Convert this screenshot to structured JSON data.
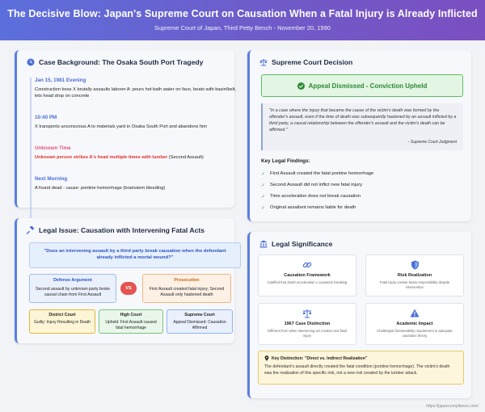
{
  "header": {
    "title": "The Decisive Blow: Japan's Supreme Court on Causation When a Fatal Injury is Already Inflicted",
    "subtitle": "Supreme Court of Japan, Third Petty Bench - November 20, 1990"
  },
  "background": {
    "title": "Case Background: The Osaka South Port Tragedy",
    "events": [
      {
        "time": "Jan 15, 1981 Evening",
        "text": "Construction boss X brutally assaults laborer A: pours hot bath water on face, beats with basin/belt, lets head drop on concrete"
      },
      {
        "time": "10:40 PM",
        "text": "X transports unconscious A to materials yard in Osaka South Port and abandons him"
      },
      {
        "time": "Unknown Time",
        "danger": "Unknown person strikes A's head multiple times with lumber",
        "text_after": " (Second Assault)"
      },
      {
        "time": "Next Morning",
        "text": "A found dead - cause: pontine hemorrhage (brainstem bleeding)"
      }
    ]
  },
  "issue": {
    "title": "Legal Issue: Causation with Intervening Fatal Acts",
    "question": "\"Does an intervening assault by a third party break causation when the defendant already inflicted a mortal wound?\"",
    "defense": {
      "heading": "Defense Argument",
      "text": "Second assault by unknown party broke causal chain from First Assault"
    },
    "vs": "VS",
    "prosecution": {
      "heading": "Prosecution",
      "text": "First Assault created fatal injury; Second Assault only hastened death"
    },
    "courts": [
      {
        "heading": "District Court",
        "text": "Guilty: Injury Resulting in Death"
      },
      {
        "heading": "High Court",
        "text": "Upheld: First Assault caused fatal hemorrhage"
      },
      {
        "heading": "Supreme Court",
        "text": "Appeal Dismissed: Causation Affirmed"
      }
    ]
  },
  "decision": {
    "title": "Supreme Court Decision",
    "result": "Appeal Dismissed - Conviction Upheld",
    "quote": "\"In a case where the injury that became the cause of the victim's death was formed by the offender's assault, even if the time of death was subsequently hastened by an assault inflicted by a third party, a causal relationship between the offender's assault and the victim's death can be affirmed.\"",
    "quote_source": "- Supreme Court Judgment",
    "findings_title": "Key Legal Findings:",
    "findings": [
      "First Assault created the fatal pontine hemorrhage",
      "Second Assault did not inflict new fatal injury",
      "Time acceleration does not break causation",
      "Original assailant remains liable for death"
    ]
  },
  "significance": {
    "title": "Legal Significance",
    "items": [
      {
        "heading": "Causation Framework",
        "text": "Clarified that death acceleration ≠ causation breaking",
        "icon": "link-icon"
      },
      {
        "heading": "Risk Realization",
        "text": "Fatal injury creator bears responsibility despite intervention",
        "icon": "shield-icon"
      },
      {
        "heading": "1967 Case Distinction",
        "text": "Different from when intervening act creates new fatal injury",
        "icon": "scale-icon"
      },
      {
        "heading": "Academic Impact",
        "text": "Challenged foreseeability requirement in adequate causation theory",
        "icon": "warning-icon"
      }
    ],
    "key_heading": "Key Distinction: \"Direct vs. Indirect Realization\"",
    "key_text": "The defendant's assault directly created the fatal condition (pontine hemorrhage). The victim's death was the realization of this specific risk, not a new risk created by the lumber attack."
  },
  "footer": "https://japancompliance.com/",
  "colors": {
    "accent": "#5b7fe0",
    "danger": "#e0312f",
    "success": "#2b8a34",
    "header_start": "#5b6fdc",
    "header_end": "#7b4fc0"
  }
}
